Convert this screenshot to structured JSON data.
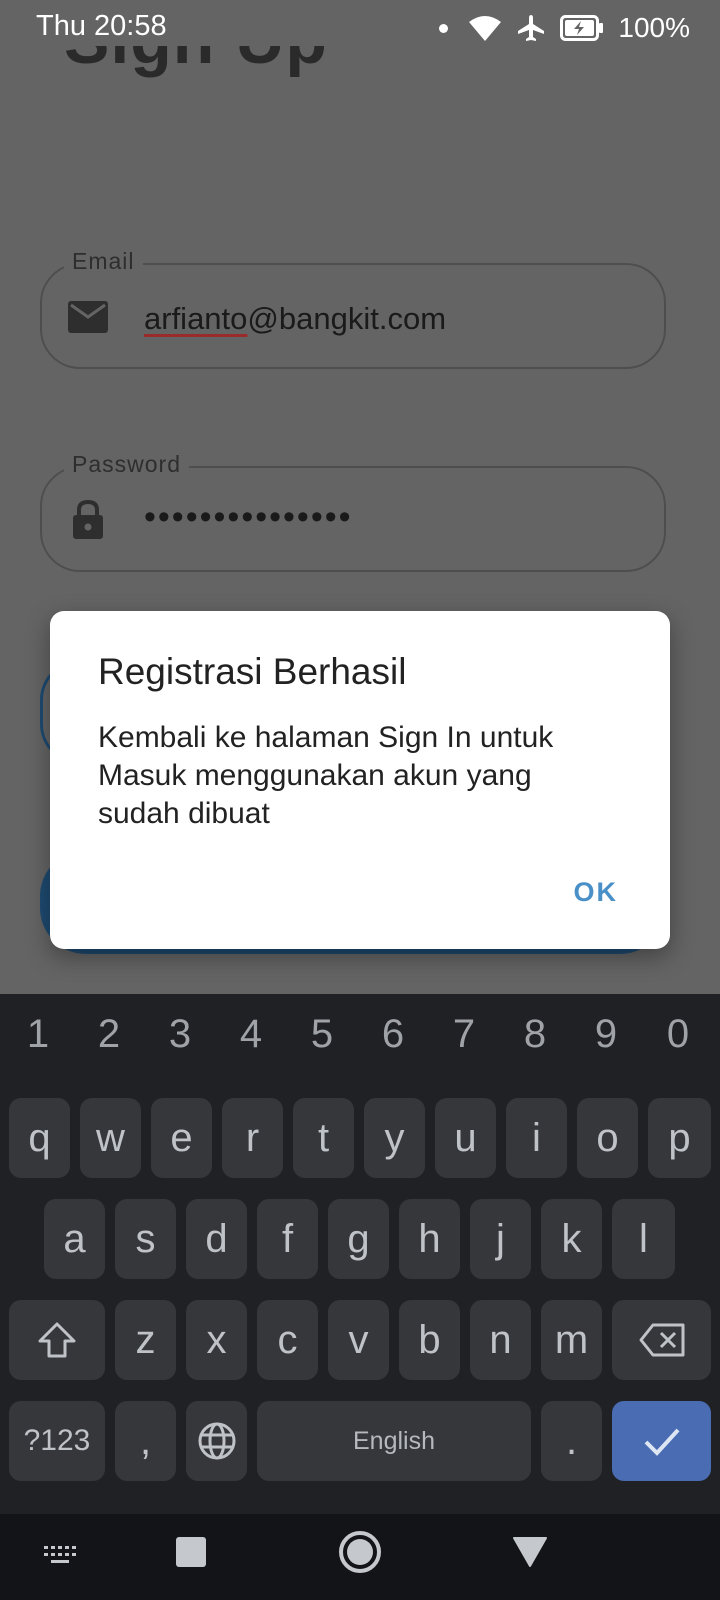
{
  "status_bar": {
    "time": "Thu 20:58",
    "battery_percent": "100%",
    "icons": [
      "notification-dot-icon",
      "wifi-icon",
      "airplane-mode-icon",
      "battery-charging-icon"
    ]
  },
  "form": {
    "title_partial": "Sign Up",
    "email": {
      "label": "Email",
      "value_misspelled": "arfianto",
      "value_rest": "@bangkit.com",
      "icon": "envelope-icon"
    },
    "password": {
      "label": "Password",
      "value": "•••••••••••••••",
      "icon": "lock-icon"
    }
  },
  "dialog": {
    "title": "Registrasi Berhasil",
    "message": "Kembali ke halaman Sign In untuk Masuk menggunakan akun yang sudah dibuat",
    "ok_label": "OK",
    "ok_color": "#4a90c8"
  },
  "keyboard": {
    "number_row": [
      "1",
      "2",
      "3",
      "4",
      "5",
      "6",
      "7",
      "8",
      "9",
      "0"
    ],
    "row1": [
      "q",
      "w",
      "e",
      "r",
      "t",
      "y",
      "u",
      "i",
      "o",
      "p"
    ],
    "row2": [
      "a",
      "s",
      "d",
      "f",
      "g",
      "h",
      "j",
      "k",
      "l"
    ],
    "row3": [
      "z",
      "x",
      "c",
      "v",
      "b",
      "n",
      "m"
    ],
    "symbols_label": "?123",
    "comma": ",",
    "space_label": "English",
    "period": ".",
    "enter_color": "#4a6cb3"
  },
  "nav_bar": {
    "icons": [
      "keyboard-switch-icon",
      "recents-icon",
      "home-icon",
      "back-icon"
    ]
  }
}
